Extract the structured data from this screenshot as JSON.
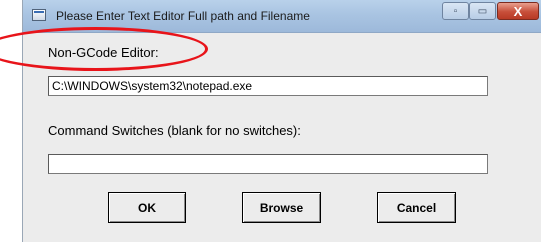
{
  "window": {
    "title": "Please Enter Text Editor Full path and Filename",
    "minimize_glyph": "▫",
    "maximize_glyph": "▭",
    "close_glyph": "X"
  },
  "editor": {
    "label": "Non-GCode Editor:",
    "value": "C:\\WINDOWS\\system32\\notepad.exe"
  },
  "switches": {
    "label": "Command Switches (blank for no switches):",
    "value": ""
  },
  "buttons": {
    "ok": "OK",
    "browse": "Browse",
    "cancel": "Cancel"
  },
  "colors": {
    "highlight": "#e8141a",
    "close_button": "#c74f3a"
  }
}
